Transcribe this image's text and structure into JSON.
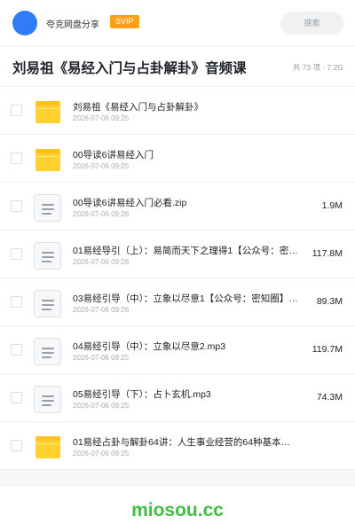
{
  "header": {
    "app_name": "夸克网盘分享",
    "badge": "SVIP",
    "search_placeholder": "搜索"
  },
  "folder": {
    "title": "刘易祖《易经入门与占卦解卦》音频课",
    "count": "共 73 项 · 7.2G"
  },
  "files": [
    {
      "name": "刘易祖《易经入门与占卦解卦》",
      "date": "2026-07-06 09:25",
      "size": "",
      "type": "folder-icon"
    },
    {
      "name": "00导读6讲易经入门",
      "date": "2026-07-06 09:25",
      "size": "",
      "type": "folder-icon"
    },
    {
      "name": "00导读6讲易经入门必看.zip",
      "date": "2026-07-06 09:26",
      "size": "1.9M",
      "type": "file-icon"
    },
    {
      "name": "01易经导引（上）：易简而天下之理得1【公众号：密…",
      "date": "2026-07-06 09:26",
      "size": "117.8M",
      "type": "file-icon"
    },
    {
      "name": "03易经引导（中）：立象以尽意1【公众号：密知圈】…",
      "date": "2026-07-06 09:26",
      "size": "89.3M",
      "type": "file-icon"
    },
    {
      "name": "04易经引导（中）：立象以尽意2.mp3",
      "date": "2026-07-06 09:25",
      "size": "119.7M",
      "type": "file-icon"
    },
    {
      "name": "05易经引导（下）：占卜玄机.mp3",
      "date": "2026-07-06 09:25",
      "size": "74.3M",
      "type": "file-icon"
    },
    {
      "name": "01易经占卦与解卦64讲：人生事业经营的64种基本…",
      "date": "2026-07-06 09:25",
      "size": "",
      "type": "folder-icon"
    }
  ],
  "footer": {
    "watermark": "miosou.cc"
  },
  "colors": {
    "accent": "#2f7cf6",
    "badge": "#ff9f1a",
    "folder": "#ffd12e",
    "watermark": "#3fbe3f"
  }
}
